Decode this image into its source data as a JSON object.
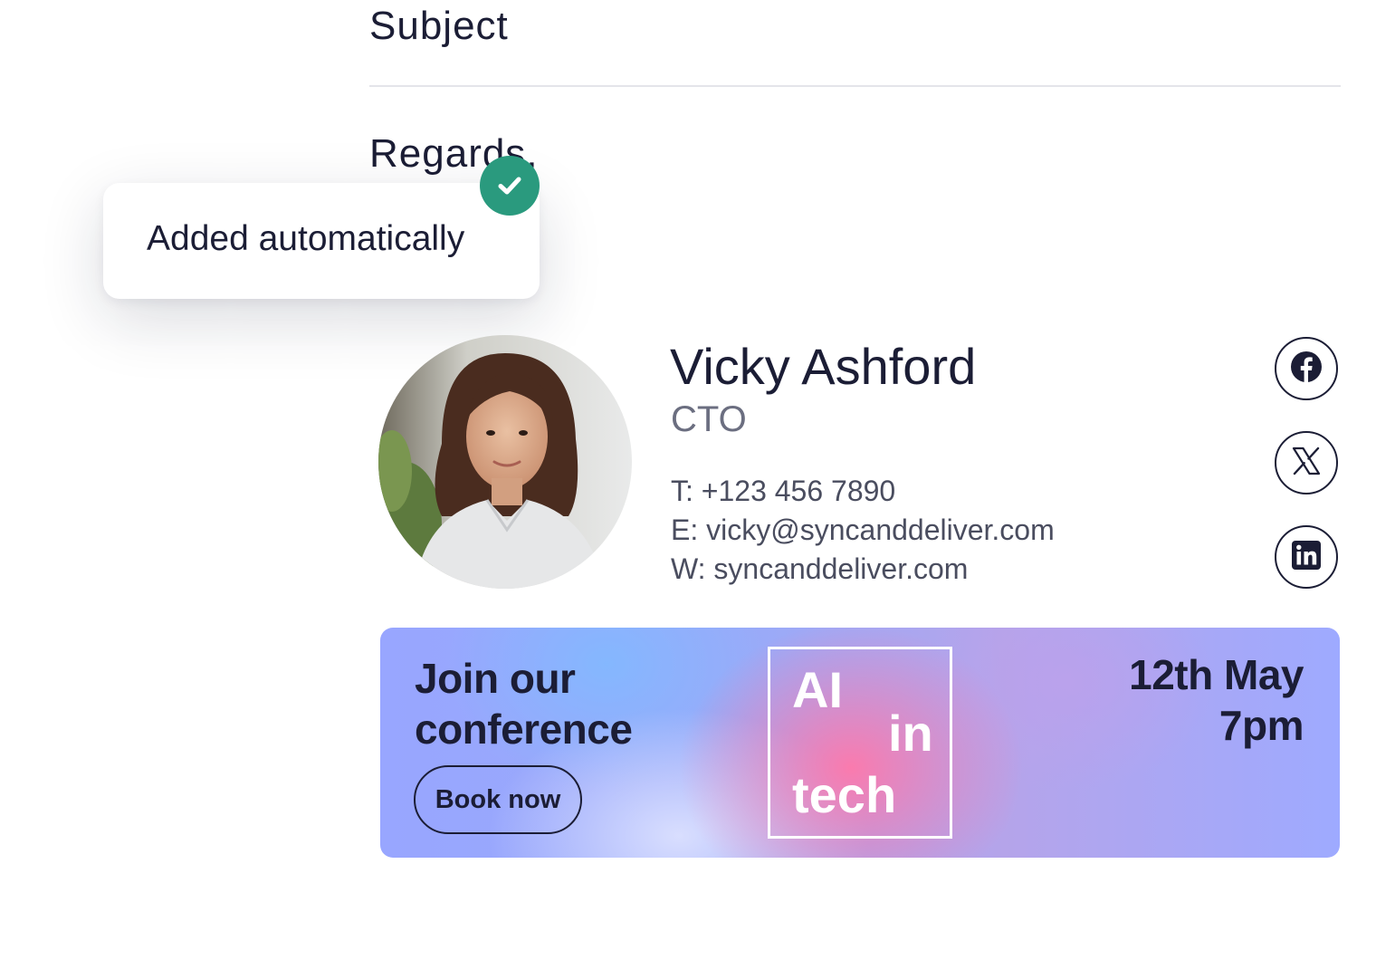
{
  "compose": {
    "subject_label": "Subject",
    "body_text": "Regards,"
  },
  "toast": {
    "message": "Added automatically",
    "icon": "check-icon",
    "badge_color": "#2a9a7e"
  },
  "signature": {
    "photo": "profile-photo",
    "name": "Vicky Ashford",
    "role": "CTO",
    "phone": "T: +123 456 7890",
    "email": "E: vicky@syncanddeliver.com",
    "website": "W: syncanddeliver.com",
    "socials": [
      {
        "icon": "facebook-icon"
      },
      {
        "icon": "x-twitter-icon"
      },
      {
        "icon": "linkedin-icon"
      }
    ]
  },
  "banner": {
    "headline_line1": "Join our",
    "headline_line2": "conference",
    "cta_label": "Book now",
    "logo_word1": "AI",
    "logo_word2": "in",
    "logo_word3": "tech",
    "date": "12th May",
    "time": "7pm"
  },
  "colors": {
    "text_primary": "#1b1d35",
    "text_secondary": "#6b6e80",
    "divider": "#e4e5ea"
  }
}
